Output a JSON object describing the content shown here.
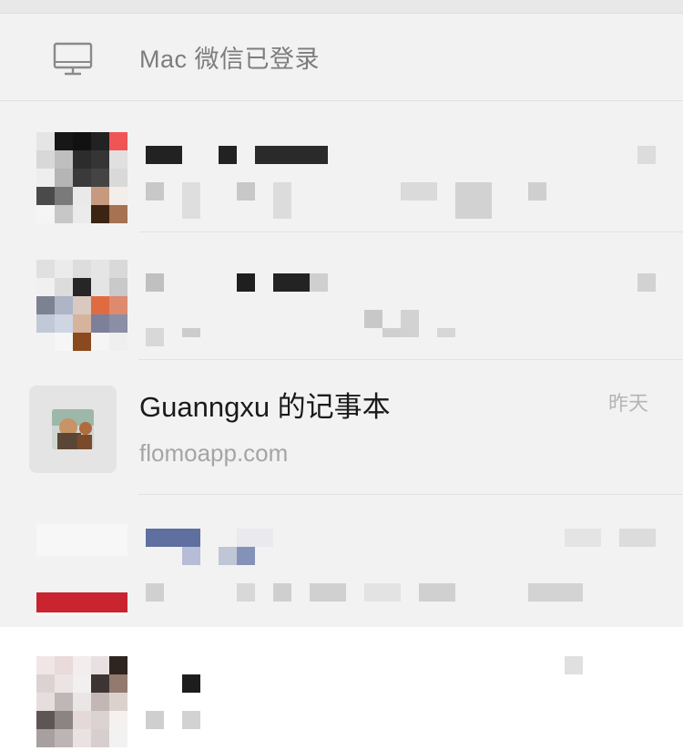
{
  "banner": {
    "icon": "monitor-icon",
    "label": "Mac 微信已登录"
  },
  "chats": [
    {
      "name": "Guanngxu 的记事本",
      "subtitle": "flomoapp.com",
      "time": "昨天",
      "avatar_icon": "notebook-avatar"
    }
  ],
  "colors": {
    "background": "#f2f2f2",
    "name_text": "#1a1a1a",
    "secondary_text": "#a5a5a5",
    "banner_text": "#7d7d7d"
  }
}
